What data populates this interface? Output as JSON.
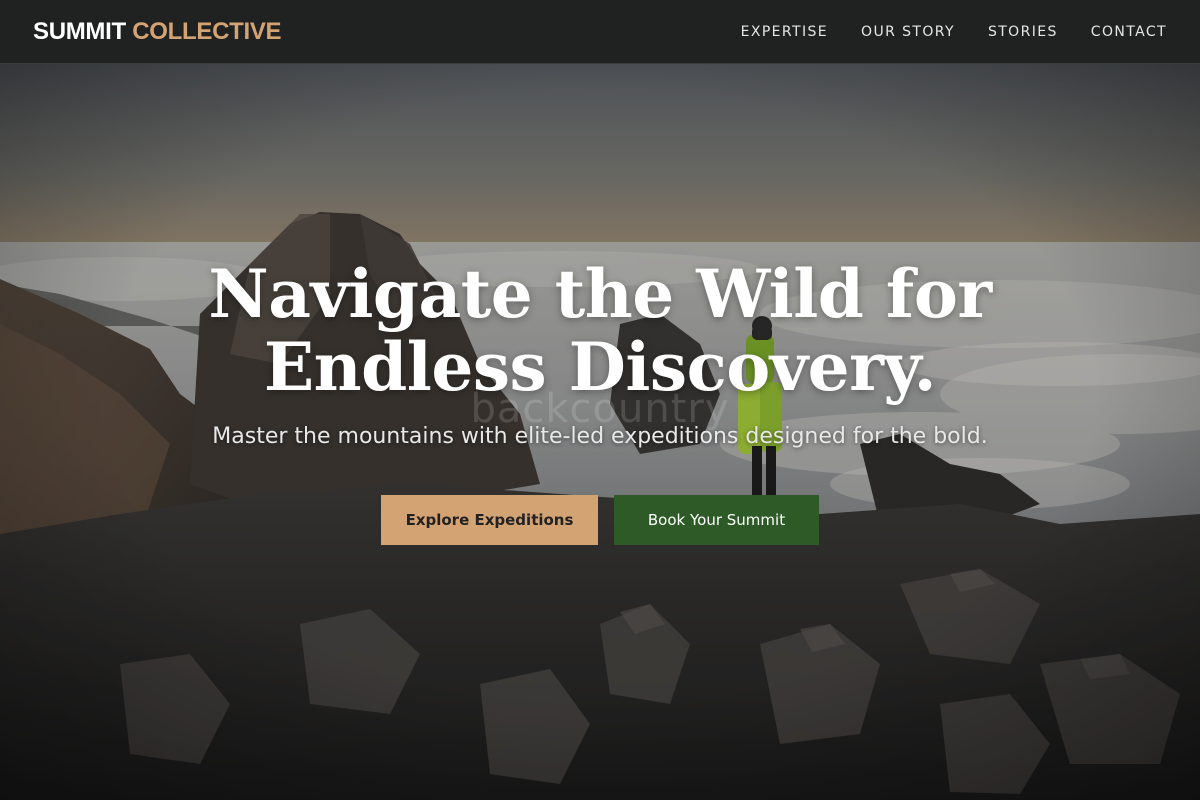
{
  "header": {
    "brand_primary": "SUMMIT",
    "brand_accent": "COLLECTIVE",
    "nav": [
      {
        "label": "EXPERTISE"
      },
      {
        "label": "OUR STORY"
      },
      {
        "label": "STORIES"
      },
      {
        "label": "CONTACT"
      }
    ]
  },
  "hero": {
    "headline_line1": "Navigate the Wild for",
    "headline_line2": "Endless Discovery.",
    "background_word": "backcountry",
    "subheadline": "Master the mountains with elite-led expeditions designed for the bold.",
    "primary_cta": "Explore Expeditions",
    "secondary_cta": "Book Your Summit"
  },
  "colors": {
    "accent": "#d4a373",
    "forest": "#2d5a27",
    "header_bg": "#202222",
    "text_light": "#ffffff"
  },
  "icons": [
    "hiker-illustration",
    "mountain-scene"
  ]
}
